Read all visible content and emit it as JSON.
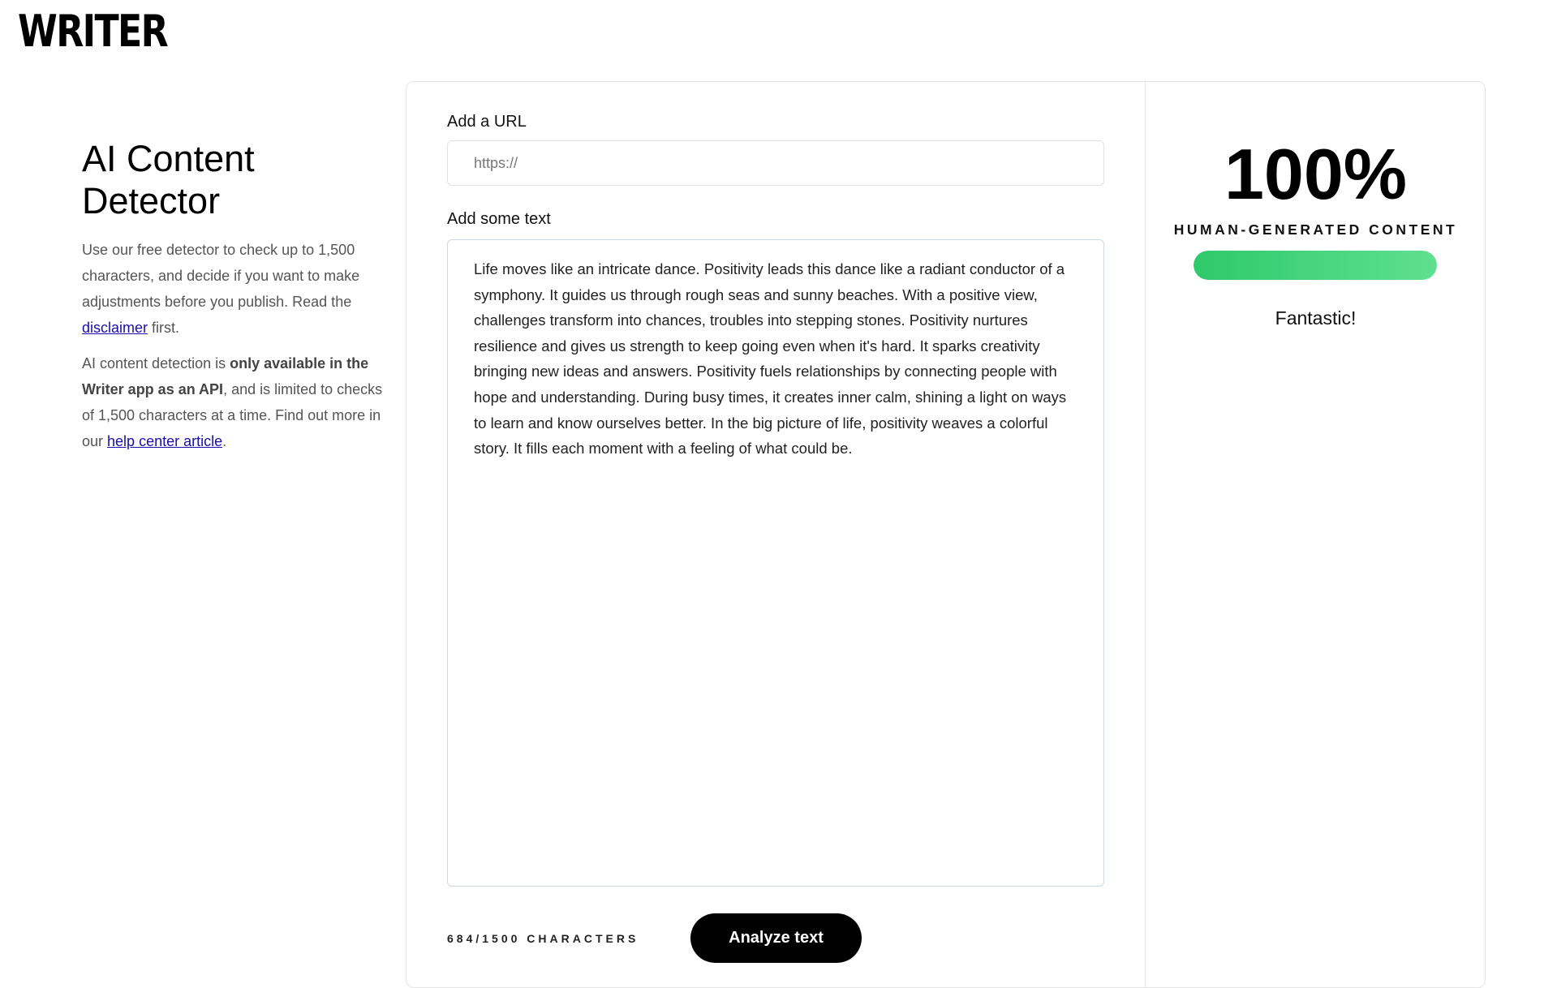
{
  "brand": {
    "logo_text": "WRITER"
  },
  "intro": {
    "title": "AI Content Detector",
    "p1_before_link": "Use our free detector to check up to 1,500 characters, and decide if you want to make adjustments before you publish. Read the ",
    "p1_link": "disclaimer",
    "p1_after_link": " first.",
    "p2_before_bold": "AI content detection is ",
    "p2_bold": "only available in the Writer app as an API",
    "p2_middle": ", and is limited to checks of 1,500 characters at a time. Find out more in our ",
    "p2_link": "help center article",
    "p2_after_link": "."
  },
  "form": {
    "url_label": "Add a URL",
    "url_placeholder": "https://",
    "url_value": "",
    "text_label": "Add some text",
    "text_value": "Life moves like an intricate dance. Positivity leads this dance like a radiant conductor of a symphony. It guides us through rough seas and sunny beaches. With a positive view, challenges transform into chances, troubles into stepping stones. Positivity nurtures resilience and gives us strength to keep going even when it's hard. It sparks creativity bringing new ideas and answers. Positivity fuels relationships by connecting people with hope and understanding. During busy times, it creates inner calm, shining a light on ways to learn and know ourselves better. In the big picture of life, positivity weaves a colorful story. It fills each moment with a feeling of what could be.",
    "char_count": "684/1500 CHARACTERS",
    "analyze_label": "Analyze text"
  },
  "result": {
    "score": "100%",
    "label": "HUMAN-GENERATED CONTENT",
    "bar_fraction": 1.0,
    "bar_color": "#2ec96a",
    "verdict": "Fantastic!"
  }
}
